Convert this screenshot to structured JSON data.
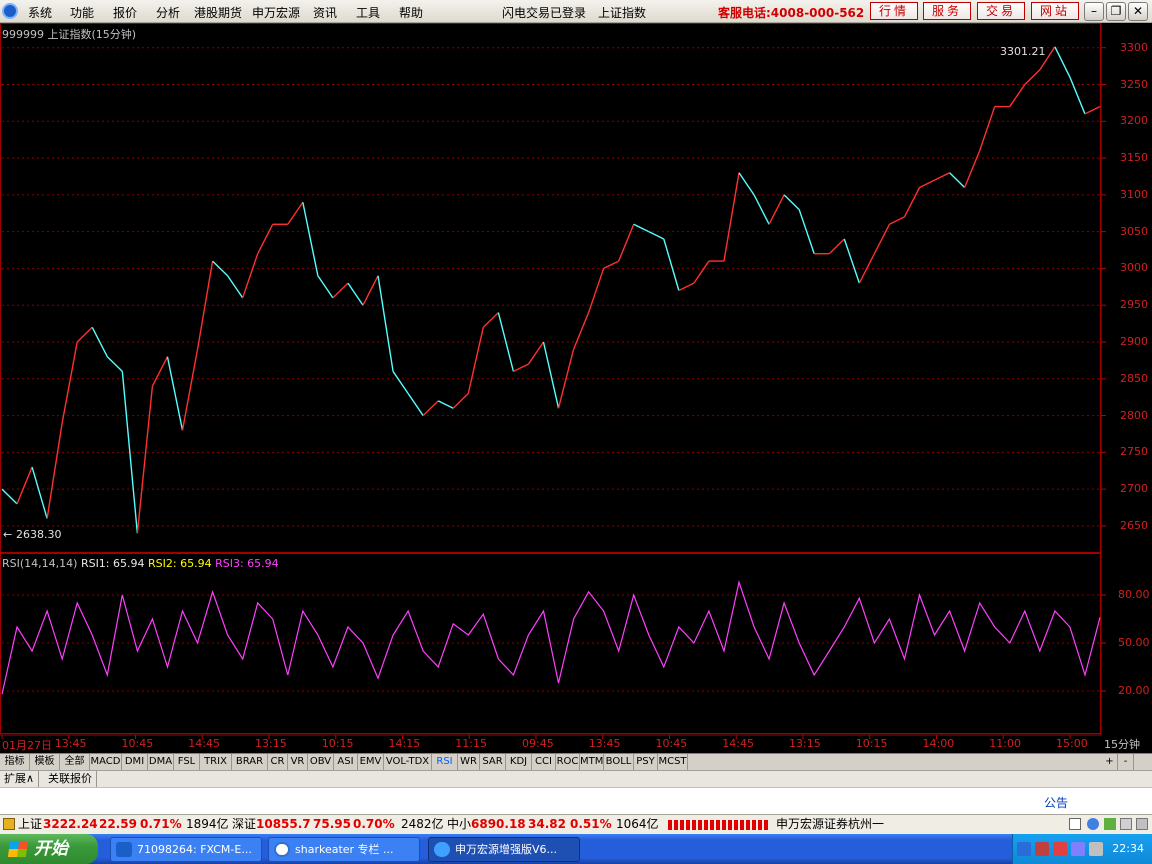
{
  "menubar": {
    "items": [
      "系统",
      "功能",
      "报价",
      "分析",
      "港股期货",
      "申万宏源",
      "资讯",
      "工具",
      "帮助"
    ],
    "status_login": "闪电交易已登录",
    "status_index": "上证指数",
    "hotline": "客服电话:4008-000-562",
    "tabs": [
      "行情",
      "服务",
      "交易",
      "网站"
    ]
  },
  "chart_header": {
    "code": "999999",
    "name": "上证指数(15分钟)"
  },
  "price_panel": {
    "high_label": "3301.21",
    "low_label": "2638.30",
    "y_ticks": [
      "3300",
      "3250",
      "3200",
      "3150",
      "3100",
      "3050",
      "3000",
      "2950",
      "2900",
      "2850",
      "2800",
      "2750",
      "2700",
      "2650"
    ]
  },
  "rsi_panel": {
    "label": "RSI(14,14,14)",
    "rsi1_label": "RSI1:",
    "rsi1_value": "65.94",
    "rsi2_label": "RSI2:",
    "rsi2_value": "65.94",
    "rsi3_label": "RSI3:",
    "rsi3_value": "65.94",
    "y_ticks": [
      "80.00",
      "50.00",
      "20.00"
    ]
  },
  "time_axis": {
    "labels": [
      "01月27日",
      "13:45",
      "10:45",
      "14:45",
      "13:15",
      "10:15",
      "14:15",
      "11:15",
      "09:45",
      "13:45",
      "10:45",
      "14:45",
      "13:15",
      "10:15",
      "14:00",
      "11:00",
      "15:00"
    ],
    "period": "15分钟"
  },
  "indicator_tabs": [
    "指标",
    "模板",
    "全部",
    "MACD",
    "DMI",
    "DMA",
    "FSL",
    "TRIX",
    "BRAR",
    "CR",
    "VR",
    "OBV",
    "ASI",
    "EMV",
    "VOL-TDX",
    "RSI",
    "WR",
    "SAR",
    "KDJ",
    "CCI",
    "ROC",
    "MTM",
    "BOLL",
    "PSY",
    "MCST"
  ],
  "indicator_selected": "RSI",
  "indicator_controls": [
    "+",
    "-"
  ],
  "ext_tabs": [
    "扩展∧",
    "关联报价"
  ],
  "announcement": "公告",
  "statusbar": {
    "sh_name": "上证",
    "sh_price": "3222.24",
    "sh_change": "22.59",
    "sh_pct": "0.71%",
    "sh_amount": "1894亿",
    "sz_name": "深证",
    "sz_price": "10855.7",
    "sz_change": "75.95",
    "sz_pct": "0.70%",
    "sz_amount": "2482亿",
    "sme_name": "中小",
    "sme_price": "6890.18",
    "sme_change": "34.82",
    "sme_pct": "0.51%",
    "sme_amount": "1064亿",
    "broker": "申万宏源证券杭州一"
  },
  "taskbar": {
    "start": "开始",
    "tasks": [
      "71098264: FXCM-E...",
      "sharkeater 专栏 ...",
      "申万宏源增强版V6..."
    ],
    "clock": "22:34"
  },
  "chart_data": {
    "type": "line",
    "title": "999999 上证指数(15分钟)",
    "series": [
      {
        "name": "上证指数",
        "values": [
          2700,
          2680,
          2730,
          2660,
          2790,
          2900,
          2920,
          2880,
          2860,
          2640,
          2840,
          2880,
          2780,
          2890,
          3010,
          2990,
          2960,
          3020,
          3060,
          3060,
          3090,
          2990,
          2960,
          2980,
          2950,
          2990,
          2860,
          2830,
          2800,
          2820,
          2810,
          2830,
          2920,
          2940,
          2860,
          2870,
          2900,
          2810,
          2890,
          2940,
          3000,
          3010,
          3060,
          3050,
          3040,
          2970,
          2980,
          3010,
          3010,
          3130,
          3100,
          3060,
          3100,
          3080,
          3020,
          3020,
          3040,
          2980,
          3020,
          3060,
          3070,
          3110,
          3120,
          3130,
          3110,
          3160,
          3220,
          3220,
          3250,
          3270,
          3301.21,
          3260,
          3210,
          3220
        ]
      },
      {
        "name": "RSI1",
        "values": [
          18,
          60,
          45,
          70,
          40,
          75,
          55,
          30,
          80,
          45,
          65,
          35,
          70,
          50,
          82,
          55,
          40,
          75,
          65,
          30,
          70,
          55,
          35,
          60,
          50,
          28,
          55,
          70,
          45,
          35,
          62,
          55,
          68,
          40,
          30,
          55,
          70,
          25,
          65,
          82,
          70,
          45,
          80,
          55,
          35,
          60,
          50,
          70,
          45,
          88,
          60,
          40,
          75,
          50,
          30,
          45,
          60,
          78,
          50,
          65,
          40,
          80,
          55,
          70,
          45,
          75,
          60,
          50,
          70,
          45,
          70,
          60,
          30,
          66
        ]
      }
    ],
    "high": 3301.21,
    "low": 2638.3,
    "ylim": [
      2620,
      3320
    ],
    "rsi_ylim": [
      0,
      100
    ],
    "grid": true
  }
}
